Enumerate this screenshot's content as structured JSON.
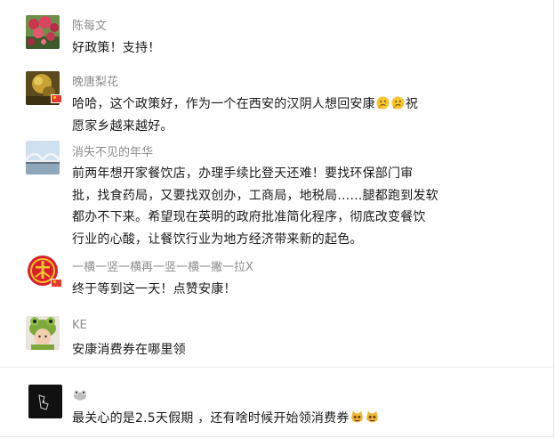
{
  "comments": [
    {
      "username": "陈每文",
      "lines": [
        "好政策！支持！"
      ]
    },
    {
      "username": "晚唐梨花",
      "lines": [
        "哈哈，这个政策好，作为一个在西安的汉阴人想回安康",
        "愿家乡越来越好。"
      ],
      "line1_suffix": "祝",
      "emoji": "thinking-face"
    },
    {
      "username": "消失不见的年华",
      "lines": [
        "前两年想开家餐饮店，办理手续比登天还难！要找环保部门审",
        "批，找食药局，又要找双创办，工商局，地税局……腿都跑到发软",
        "都办不下来。希望现在英明的政府批准简化程序，彻底改变餐饮",
        "行业的心酸，让餐饮行业为地方经济带来新的起色。"
      ]
    },
    {
      "username": "一横一竖一横再一竖一横一撇一拉X",
      "lines": [
        "终于等到这一天！点赞安康！"
      ]
    },
    {
      "username": "KE",
      "lines": [
        "安康消费券在哪里领"
      ]
    },
    {
      "username": "",
      "lines": [
        "最关心的是2.5天假期 ，还有啥时候开始领消费券"
      ],
      "emoji": "cat-face"
    }
  ],
  "colors": {
    "username": "#8c8c8c",
    "content": "#1a1a1a",
    "divider": "#ececec",
    "badge": "#e53a2f"
  }
}
